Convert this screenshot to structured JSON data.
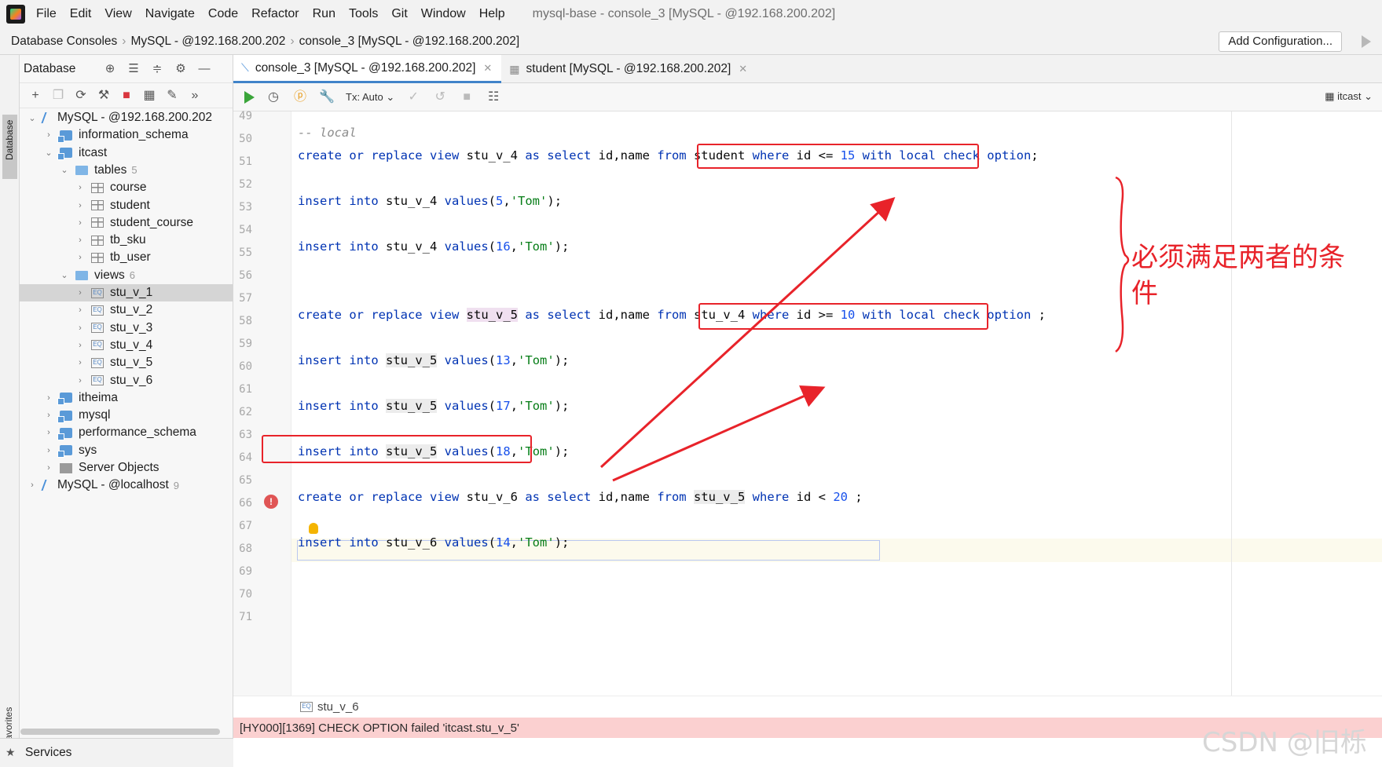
{
  "menu": [
    "File",
    "Edit",
    "View",
    "Navigate",
    "Code",
    "Refactor",
    "Run",
    "Tools",
    "Git",
    "Window",
    "Help"
  ],
  "window_title": "mysql-base - console_3 [MySQL - @192.168.200.202]",
  "breadcrumb": [
    "Database Consoles",
    "MySQL - @192.168.200.202",
    "console_3 [MySQL - @192.168.200.202]"
  ],
  "add_config": "Add Configuration...",
  "left_stripe": {
    "database": "Database",
    "favorites": "Favorites"
  },
  "db_panel": {
    "title": "Database",
    "tree": [
      {
        "label": "MySQL - @192.168.200.202",
        "count": "",
        "indent": 0,
        "chev": "⌄",
        "icon": "db-conn",
        "selected": false
      },
      {
        "label": "information_schema",
        "count": "",
        "indent": 1,
        "chev": "›",
        "icon": "schema",
        "selected": false
      },
      {
        "label": "itcast",
        "count": "",
        "indent": 1,
        "chev": "⌄",
        "icon": "schema",
        "selected": false
      },
      {
        "label": "tables",
        "count": "5",
        "indent": 2,
        "chev": "⌄",
        "icon": "folder",
        "selected": false
      },
      {
        "label": "course",
        "count": "",
        "indent": 3,
        "chev": "›",
        "icon": "table",
        "selected": false
      },
      {
        "label": "student",
        "count": "",
        "indent": 3,
        "chev": "›",
        "icon": "table",
        "selected": false
      },
      {
        "label": "student_course",
        "count": "",
        "indent": 3,
        "chev": "›",
        "icon": "table",
        "selected": false
      },
      {
        "label": "tb_sku",
        "count": "",
        "indent": 3,
        "chev": "›",
        "icon": "table",
        "selected": false
      },
      {
        "label": "tb_user",
        "count": "",
        "indent": 3,
        "chev": "›",
        "icon": "table",
        "selected": false
      },
      {
        "label": "views",
        "count": "6",
        "indent": 2,
        "chev": "⌄",
        "icon": "folder",
        "selected": false
      },
      {
        "label": "stu_v_1",
        "count": "",
        "indent": 3,
        "chev": "›",
        "icon": "view",
        "selected": true
      },
      {
        "label": "stu_v_2",
        "count": "",
        "indent": 3,
        "chev": "›",
        "icon": "view",
        "selected": false
      },
      {
        "label": "stu_v_3",
        "count": "",
        "indent": 3,
        "chev": "›",
        "icon": "view",
        "selected": false
      },
      {
        "label": "stu_v_4",
        "count": "",
        "indent": 3,
        "chev": "›",
        "icon": "view",
        "selected": false
      },
      {
        "label": "stu_v_5",
        "count": "",
        "indent": 3,
        "chev": "›",
        "icon": "view",
        "selected": false
      },
      {
        "label": "stu_v_6",
        "count": "",
        "indent": 3,
        "chev": "›",
        "icon": "view",
        "selected": false
      },
      {
        "label": "itheima",
        "count": "",
        "indent": 1,
        "chev": "›",
        "icon": "schema",
        "selected": false
      },
      {
        "label": "mysql",
        "count": "",
        "indent": 1,
        "chev": "›",
        "icon": "schema",
        "selected": false
      },
      {
        "label": "performance_schema",
        "count": "",
        "indent": 1,
        "chev": "›",
        "icon": "schema",
        "selected": false
      },
      {
        "label": "sys",
        "count": "",
        "indent": 1,
        "chev": "›",
        "icon": "schema",
        "selected": false
      },
      {
        "label": "Server Objects",
        "count": "",
        "indent": 1,
        "chev": "›",
        "icon": "server",
        "selected": false
      },
      {
        "label": "MySQL - @localhost",
        "count": "9",
        "indent": 0,
        "chev": "›",
        "icon": "db-conn",
        "selected": false
      }
    ]
  },
  "services": "Services",
  "tabs": [
    {
      "label": "console_3 [MySQL - @192.168.200.202]",
      "active": true
    },
    {
      "label": "student [MySQL - @192.168.200.202]",
      "active": false
    }
  ],
  "toolbar": {
    "tx": "Tx: Auto",
    "schema": "itcast"
  },
  "line_numbers": [
    "49",
    "50",
    "51",
    "52",
    "53",
    "54",
    "55",
    "56",
    "57",
    "58",
    "59",
    "60",
    "61",
    "62",
    "63",
    "64",
    "65",
    "66",
    "67",
    "68",
    "69",
    "70",
    "71"
  ],
  "code": {
    "l50": "-- local",
    "l51a": "create or replace view",
    "l51b": " stu_v_4 ",
    "l51c": "as select",
    "l51d": " id,name ",
    "l51e": "from",
    "l51f": " student ",
    "l51g": "where",
    "l51h": " id <= ",
    "l51i": "15",
    "l51j": " with local check option",
    "l51k": ";",
    "l53a": "insert into",
    "l53b": " stu_v_4 ",
    "l53c": "values",
    "l53d": "(",
    "l53e": "5",
    "l53f": ",",
    "l53g": "'Tom'",
    "l53h": ");",
    "l55a": "insert into",
    "l55b": " stu_v_4 ",
    "l55c": "values",
    "l55d": "(",
    "l55e": "16",
    "l55f": ",",
    "l55g": "'Tom'",
    "l55h": ");",
    "l58a": "create or replace view",
    "l58b": "stu_v_5",
    "l58c": "as select",
    "l58d": " id,name ",
    "l58e": "from",
    "l58f": " stu_v_4 ",
    "l58g": "where",
    "l58h": " id >= ",
    "l58i": "10",
    "l58j": " with local check option",
    "l58k": " ;",
    "l60a": "insert into",
    "l60b": "stu_v_5",
    "l60c": "values",
    "l60d": "(",
    "l60e": "13",
    "l60f": ",",
    "l60g": "'Tom'",
    "l60h": ");",
    "l62a": "insert into",
    "l62b": "stu_v_5",
    "l62c": "values",
    "l62d": "(",
    "l62e": "17",
    "l62f": ",",
    "l62g": "'Tom'",
    "l62h": ");",
    "l64a": "insert into",
    "l64b": "stu_v_5",
    "l64c": "values",
    "l64d": "(",
    "l64e": "18",
    "l64f": ",",
    "l64g": "'Tom'",
    "l64h": ");",
    "l66a": "create or replace view",
    "l66b": " stu_v_6 ",
    "l66c": "as select",
    "l66d": " id,name ",
    "l66e": "from",
    "l66f": "stu_v_5",
    "l66g": "where",
    "l66h": " id < ",
    "l66i": "20",
    "l66j": " ;",
    "l68a": "insert into",
    "l68b": " stu_v_6 ",
    "l68c": "values",
    "l68d": "(",
    "l68e": "14",
    "l68f": ",",
    "l68g": "'Tom'",
    "l68h": ");"
  },
  "annotation": "必须满足两者的条件",
  "editor_breadcrumb": "stu_v_6",
  "error_message": "[HY000][1369] CHECK OPTION failed 'itcast.stu_v_5'",
  "watermark": "CSDN @旧栎",
  "colors": {
    "annotation_red": "#e8232a",
    "error_bg": "#fbd0d0",
    "keyword": "#0033b3",
    "string": "#067d17",
    "number": "#1750eb"
  }
}
